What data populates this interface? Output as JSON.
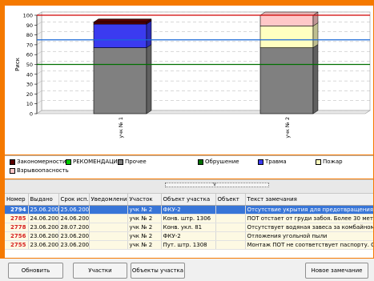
{
  "chart_data": {
    "type": "bar",
    "stacked": true,
    "ylabel": "Риск",
    "ylim": [
      0,
      100
    ],
    "yticks": [
      0,
      10,
      20,
      30,
      40,
      50,
      60,
      70,
      80,
      90,
      100
    ],
    "ytick_labels": [
      "0",
      "10",
      "20",
      "30",
      "40",
      "50",
      "60",
      "70",
      "80",
      "90",
      "100"
    ],
    "categories": [
      "учк № 1",
      "учк № 2"
    ],
    "series": [
      {
        "name": "Прочее",
        "color": "#808080",
        "values": [
          67,
          67
        ]
      },
      {
        "name": "Травма",
        "color": "#3b3bf0",
        "values": [
          24,
          0
        ]
      },
      {
        "name": "Пожар",
        "color": "#ffffc0",
        "values": [
          0,
          22
        ]
      },
      {
        "name": "Взрывоопасность",
        "color": "#ffc8c8",
        "values": [
          0,
          11
        ]
      },
      {
        "name": "Закономерности",
        "color": "#5a0000",
        "values": [
          2,
          0
        ]
      }
    ],
    "reference_lines": [
      {
        "value": 100,
        "color": "#d00000"
      },
      {
        "value": 75,
        "color": "#1a6ad8"
      },
      {
        "value": 50,
        "color": "#007000"
      }
    ],
    "grid": "dashed-horizontal",
    "legend_placement": "bottom",
    "legend": [
      {
        "label": "Закономерности",
        "color": "#5a0000"
      },
      {
        "label": "РЕКОМЕНДАЦИИ",
        "color": "#00cc00"
      },
      {
        "label": "Прочее",
        "color": "#808080"
      },
      {
        "label": "Обрушение",
        "color": "#007000"
      },
      {
        "label": "Травма",
        "color": "#3b3bf0"
      },
      {
        "label": "Пожар",
        "color": "#ffffc0"
      },
      {
        "label": "Взрывоопасность",
        "color": "#ffc8c8"
      }
    ]
  },
  "table": {
    "columns": [
      "Номер",
      "Выдано",
      "Срок исп.",
      "Уведомление",
      "Участок",
      "Объект участка",
      "Объект",
      "Текст замечания"
    ],
    "rows": [
      {
        "num": "2794",
        "issued": "25.06.200...",
        "due": "25.06.200...",
        "notice": "",
        "section": "учк № 2",
        "section_object": "ФКУ-2",
        "object": "",
        "text": "Отсутствие укрытия для предотвращения вы...",
        "selected": true
      },
      {
        "num": "2785",
        "issued": "24.06.200...",
        "due": "24.06.200...",
        "notice": "",
        "section": "учк № 2",
        "section_object": "Конв. штр. 1306",
        "object": "",
        "text": "ПОТ отстает от груди забоя. Более 30 метров",
        "selected": false
      },
      {
        "num": "2778",
        "issued": "23.06.2009",
        "due": "28.07.200...",
        "notice": "",
        "section": "учк № 2",
        "section_object": "Конв. укл. 81",
        "object": "",
        "text": "Отсутствует водяная завеса за комбайном",
        "selected": false
      },
      {
        "num": "2756",
        "issued": "23.06.200...",
        "due": "23.06.200...",
        "notice": "",
        "section": "учк № 2",
        "section_object": "ФКУ-2",
        "object": "",
        "text": "Отложения угольной пыли",
        "selected": false
      },
      {
        "num": "2755",
        "issued": "23.06.200...",
        "due": "23.06.200...",
        "notice": "",
        "section": "учк № 2",
        "section_object": "Пут. штр. 1308",
        "object": "",
        "text": "Монтаж ПОТ не соответствует паспорту. От...",
        "selected": false
      }
    ]
  },
  "buttons": {
    "refresh": "Обновить",
    "sections": "Участки",
    "section_objects": "Объекты участка",
    "new_remark": "Новое замечание"
  },
  "splitter": {
    "arrow": "v"
  }
}
